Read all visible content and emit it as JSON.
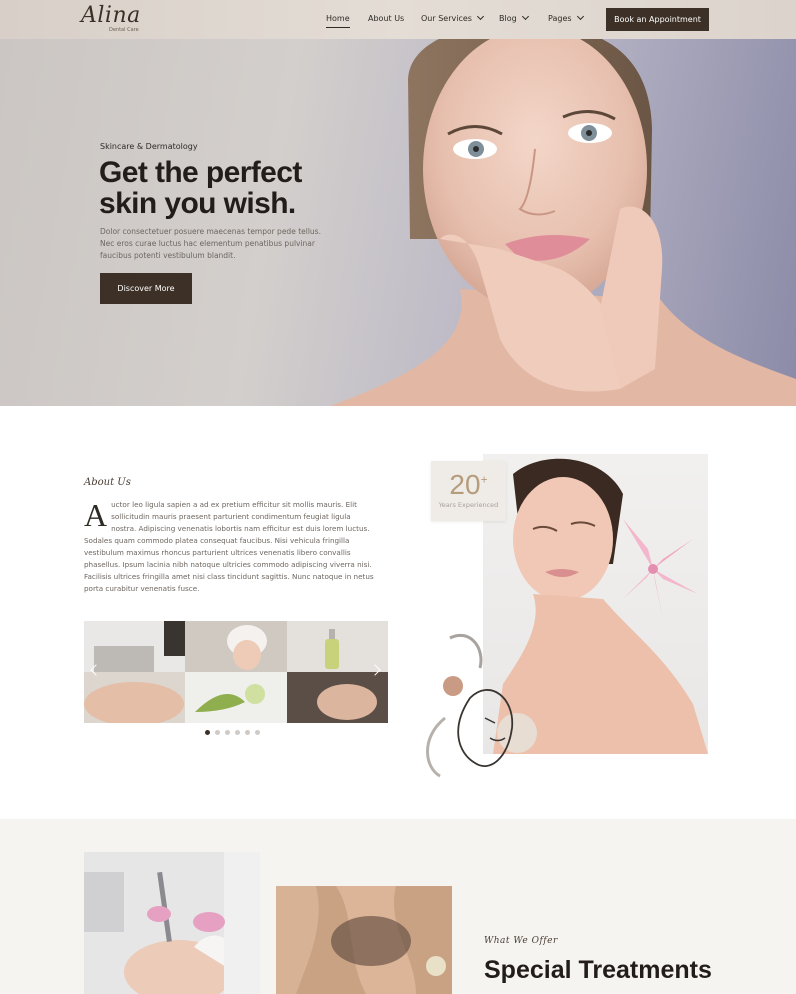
{
  "brand": {
    "name": "Alina",
    "tagline": "Dental Care"
  },
  "nav": {
    "items": [
      {
        "label": "Home"
      },
      {
        "label": "About Us"
      },
      {
        "label": "Our Services"
      },
      {
        "label": "Blog"
      },
      {
        "label": "Pages"
      }
    ],
    "cta": "Book an Appointment"
  },
  "hero": {
    "eyebrow": "Skincare & Dermatology",
    "title": "Get the perfect skin you wish.",
    "text": "Dolor consectetuer posuere maecenas tempor pede tellus. Nec eros curae luctus hac elementum penatibus pulvinar faucibus potenti vestibulum blandit.",
    "button": "Discover More"
  },
  "about": {
    "label": "About Us",
    "dropcap": "A",
    "text": "uctor leo ligula sapien a ad ex pretium efficitur sit mollis mauris. Elit sollicitudin mauris praesent parturient condimentum feugiat ligula nostra. Adipiscing venenatis lobortis nam efficitur est duis lorem luctus. Sodales quam commodo platea consequat faucibus. Nisi vehicula fringilla vestibulum maximus rhoncus parturient ultrices venenatis libero convallis phasellus. Ipsum lacinia nibh natoque ultricies commodo adipiscing viverra nisi. Facilisis ultrices fringilla amet nisi class tincidunt sagittis. Nunc natoque in netus porta curabitur venenatis fusce.",
    "experience_number": "20",
    "experience_plus": "+",
    "experience_label": "Years Experienced",
    "carousel_active_index": 0,
    "carousel_dot_count": 6
  },
  "services": {
    "label": "What We Offer",
    "title": "Special Treatments"
  },
  "colors": {
    "primary_dark": "#3d3027",
    "accent_gold": "#b59c7d",
    "section_bg": "#f5f4f1"
  }
}
